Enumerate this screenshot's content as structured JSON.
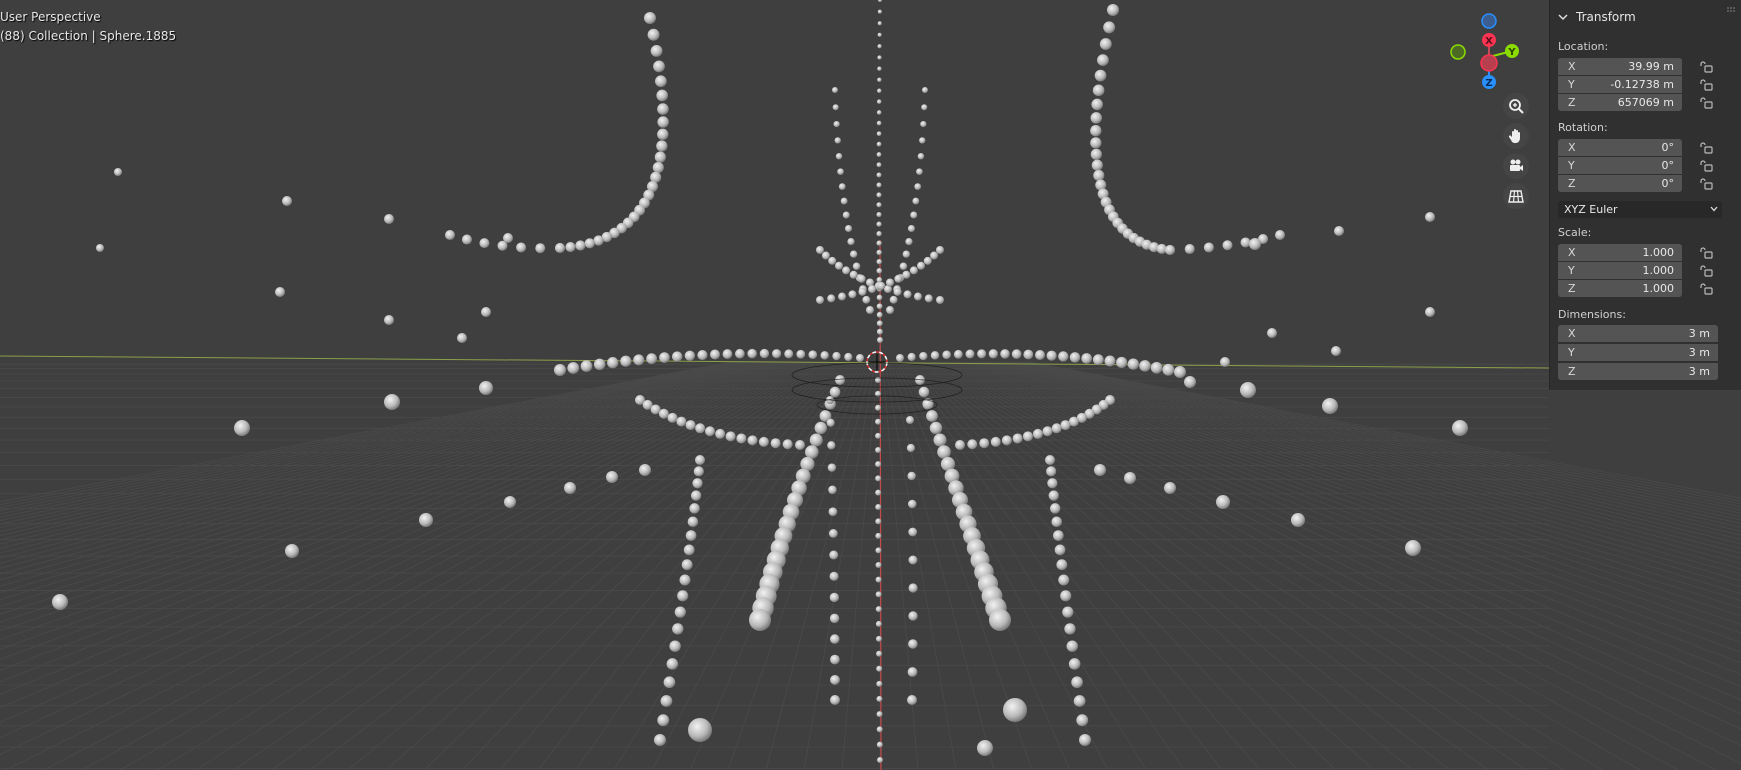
{
  "viewport": {
    "overlay": {
      "view_name": "User Perspective",
      "context": "(88) Collection | Sphere.1885"
    },
    "gizmo": {
      "x_label": "X",
      "y_label": "Y",
      "z_label": "Z",
      "x_color": "#ff3352",
      "y_color": "#8bdc00",
      "z_color": "#2890ff"
    },
    "nav_buttons": [
      "zoom-icon",
      "hand-icon",
      "camera-icon",
      "grid-icon"
    ],
    "colors": {
      "background": "#3f3f3f",
      "grid": "#4a4a4a",
      "x_axis": "#8ba04a",
      "y_axis": "#c44a4a",
      "sphere": "#bdbdbd"
    }
  },
  "sidebar": {
    "panel_title": "Transform",
    "location": {
      "label": "Location:",
      "x": {
        "axis": "X",
        "value": "39.99 m"
      },
      "y": {
        "axis": "Y",
        "value": "-0.12738 m"
      },
      "z": {
        "axis": "Z",
        "value": "657069 m"
      }
    },
    "rotation": {
      "label": "Rotation:",
      "x": {
        "axis": "X",
        "value": "0°"
      },
      "y": {
        "axis": "Y",
        "value": "0°"
      },
      "z": {
        "axis": "Z",
        "value": "0°"
      },
      "mode": "XYZ Euler"
    },
    "scale": {
      "label": "Scale:",
      "x": {
        "axis": "X",
        "value": "1.000"
      },
      "y": {
        "axis": "Y",
        "value": "1.000"
      },
      "z": {
        "axis": "Z",
        "value": "1.000"
      }
    },
    "dimensions": {
      "label": "Dimensions:",
      "x": {
        "axis": "X",
        "value": "3 m"
      },
      "y": {
        "axis": "Y",
        "value": "3 m"
      },
      "z": {
        "axis": "Z",
        "value": "3 m"
      }
    }
  }
}
